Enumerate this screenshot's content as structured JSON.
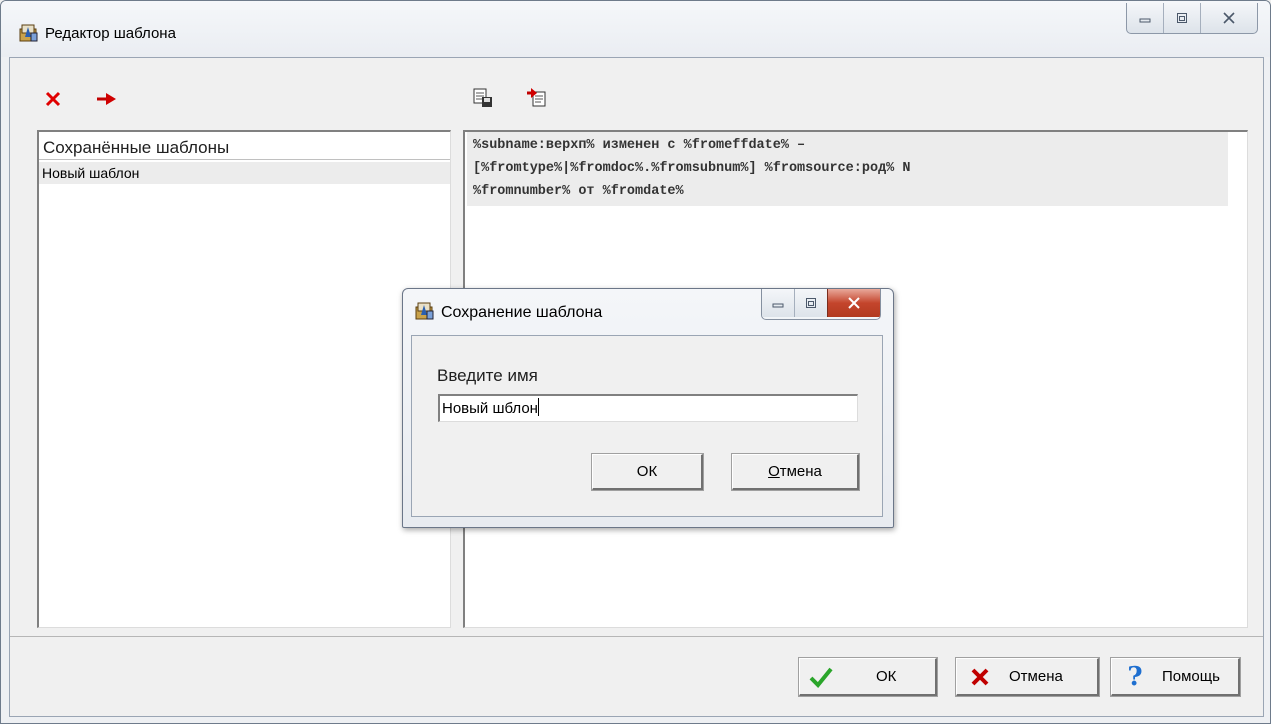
{
  "window": {
    "title": "Редактор шаблона",
    "controls": [
      "minimize",
      "restore",
      "close"
    ]
  },
  "toolbar_left": [
    {
      "icon": "delete-icon",
      "color": "#e00000"
    },
    {
      "icon": "arrow-right-icon",
      "color": "#d00000"
    }
  ],
  "toolbar_right": [
    {
      "icon": "save-template-icon"
    },
    {
      "icon": "load-template-icon"
    }
  ],
  "saved_templates": {
    "header": "Сохранённые шаблоны",
    "items": [
      "Новый шаблон"
    ]
  },
  "editor": {
    "text": "%subname:верхп% изменен с %fromeffdate% –\n[%fromtype%|%fromdoc%.%fromsubnum%] %fromsource:род% N\n%fromnumber% от %fromdate%"
  },
  "buttons": {
    "ok": "ОК",
    "cancel": "Отмена",
    "help": "Помощь"
  },
  "dialog": {
    "title": "Сохранение шаблона",
    "label": "Введите имя",
    "input_value": "Новый шблон",
    "ok": "ОК",
    "cancel_pre": "",
    "cancel_underlined": "О",
    "cancel_post": "тмена"
  },
  "colors": {
    "ok_check": "#2aa52a",
    "cancel_x": "#c00000",
    "help_q": "#1e6fd0",
    "close_button": "#c4452c"
  }
}
